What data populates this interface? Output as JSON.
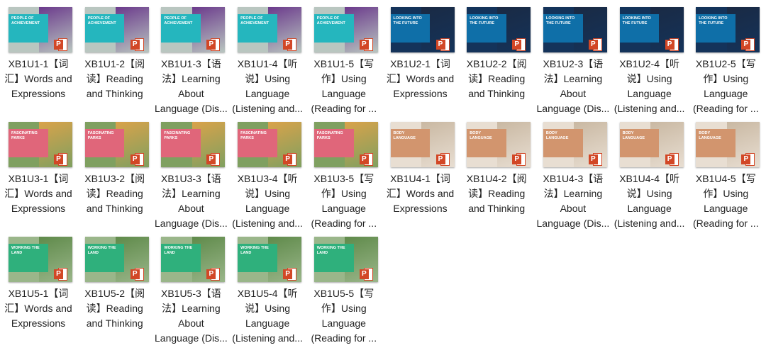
{
  "units": [
    {
      "thumb_title": "PEOPLE OF ACHIEVEMENT",
      "panel_color": "#25b6be",
      "photo_color": "#6b3a8c",
      "bg_color": "#b9c6c0"
    },
    {
      "thumb_title": "LOOKING INTO THE FUTURE",
      "panel_color": "#0f6fa8",
      "photo_color": "#1a2a44",
      "bg_color": "#14335a"
    },
    {
      "thumb_title": "FASCINATING PARKS",
      "panel_color": "#e0667a",
      "photo_color": "#d9a24a",
      "bg_color": "#7fa060"
    },
    {
      "thumb_title": "BODY LANGUAGE",
      "panel_color": "#d2956e",
      "photo_color": "#c9b8a2",
      "bg_color": "#e8ded2"
    },
    {
      "thumb_title": "WORKING THE LAND",
      "panel_color": "#2fb07c",
      "photo_color": "#5f8a4a",
      "bg_color": "#9ab68a"
    }
  ],
  "ppt_icon_letter": "P",
  "files": [
    {
      "unit": 0,
      "lines": [
        "XB1U1-1【词",
        "汇】Words and",
        "Expressions"
      ]
    },
    {
      "unit": 0,
      "lines": [
        "XB1U1-2【阅",
        "读】Reading",
        "and Thinking"
      ]
    },
    {
      "unit": 0,
      "lines": [
        "XB1U1-3【语",
        "法】Learning",
        "About",
        "Language (Dis..."
      ]
    },
    {
      "unit": 0,
      "lines": [
        "XB1U1-4【听",
        "说】Using",
        "Language",
        "(Listening and..."
      ]
    },
    {
      "unit": 0,
      "lines": [
        "XB1U1-5【写",
        "作】Using",
        "Language",
        "(Reading for ..."
      ]
    },
    {
      "unit": 1,
      "lines": [
        "XB1U2-1【词",
        "汇】Words and",
        "Expressions"
      ]
    },
    {
      "unit": 1,
      "lines": [
        "XB1U2-2【阅",
        "读】Reading",
        "and Thinking"
      ]
    },
    {
      "unit": 1,
      "lines": [
        "XB1U2-3【语",
        "法】Learning",
        "About",
        "Language (Dis..."
      ]
    },
    {
      "unit": 1,
      "lines": [
        "XB1U2-4【听",
        "说】Using",
        "Language",
        "(Listening and..."
      ]
    },
    {
      "unit": 1,
      "lines": [
        "XB1U2-5【写",
        "作】Using",
        "Language",
        "(Reading for ..."
      ]
    },
    {
      "unit": 2,
      "lines": [
        "XB1U3-1【词",
        "汇】Words and",
        "Expressions"
      ]
    },
    {
      "unit": 2,
      "lines": [
        "XB1U3-2【阅",
        "读】Reading",
        "and Thinking"
      ]
    },
    {
      "unit": 2,
      "lines": [
        "XB1U3-3【语",
        "法】Learning",
        "About",
        "Language (Dis..."
      ]
    },
    {
      "unit": 2,
      "lines": [
        "XB1U3-4【听",
        "说】Using",
        "Language",
        "(Listening and..."
      ]
    },
    {
      "unit": 2,
      "lines": [
        "XB1U3-5【写",
        "作】Using",
        "Language",
        "(Reading for ..."
      ]
    },
    {
      "unit": 3,
      "lines": [
        "XB1U4-1【词",
        "汇】Words and",
        "Expressions"
      ]
    },
    {
      "unit": 3,
      "lines": [
        "XB1U4-2【阅",
        "读】Reading",
        "and Thinking"
      ]
    },
    {
      "unit": 3,
      "lines": [
        "XB1U4-3【语",
        "法】Learning",
        "About",
        "Language (Dis..."
      ]
    },
    {
      "unit": 3,
      "lines": [
        "XB1U4-4【听",
        "说】Using",
        "Language",
        "(Listening and..."
      ]
    },
    {
      "unit": 3,
      "lines": [
        "XB1U4-5【写",
        "作】Using",
        "Language",
        "(Reading for ..."
      ]
    },
    {
      "unit": 4,
      "lines": [
        "XB1U5-1【词",
        "汇】Words and",
        "Expressions"
      ]
    },
    {
      "unit": 4,
      "lines": [
        "XB1U5-2【阅",
        "读】Reading",
        "and Thinking"
      ]
    },
    {
      "unit": 4,
      "lines": [
        "XB1U5-3【语",
        "法】Learning",
        "About",
        "Language (Dis..."
      ]
    },
    {
      "unit": 4,
      "lines": [
        "XB1U5-4【听",
        "说】Using",
        "Language",
        "(Listening and..."
      ]
    },
    {
      "unit": 4,
      "lines": [
        "XB1U5-5【写",
        "作】Using",
        "Language",
        "(Reading for ..."
      ]
    }
  ]
}
